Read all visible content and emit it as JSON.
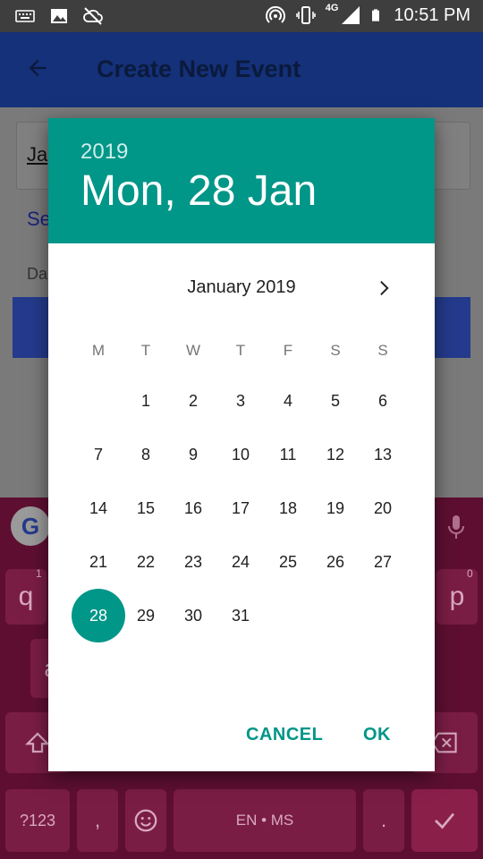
{
  "status_bar": {
    "time": "10:51 PM",
    "network": "4G",
    "icons_left": [
      "keyboard-icon",
      "image-icon",
      "cloud-off-icon"
    ],
    "icons_right": [
      "hotspot-icon",
      "vibrate-icon",
      "signal-icon",
      "battery-icon"
    ]
  },
  "app_bar": {
    "title": "Create New Event",
    "back_icon": "arrow-back-icon"
  },
  "background": {
    "field_value": "Ja",
    "link_text": "Se",
    "label_text": "Da"
  },
  "dialog": {
    "year": "2019",
    "selected_date": "Mon, 28 Jan",
    "month_title": "January 2019",
    "weekdays": [
      "M",
      "T",
      "W",
      "T",
      "F",
      "S",
      "S"
    ],
    "weeks": [
      [
        "",
        "1",
        "2",
        "3",
        "4",
        "5",
        "6"
      ],
      [
        "7",
        "8",
        "9",
        "10",
        "11",
        "12",
        "13"
      ],
      [
        "14",
        "15",
        "16",
        "17",
        "18",
        "19",
        "20"
      ],
      [
        "21",
        "22",
        "23",
        "24",
        "25",
        "26",
        "27"
      ],
      [
        "28",
        "29",
        "30",
        "31",
        "",
        "",
        ""
      ]
    ],
    "selected_day": "28",
    "cancel_label": "CANCEL",
    "ok_label": "OK",
    "accent": "#009688"
  },
  "keyboard": {
    "keys": {
      "q": "q",
      "q_hint": "1",
      "p": "p",
      "p_hint": "0",
      "a": "a",
      "symbols": "?123",
      "comma": ",",
      "space": "EN • MS",
      "period": "."
    }
  }
}
